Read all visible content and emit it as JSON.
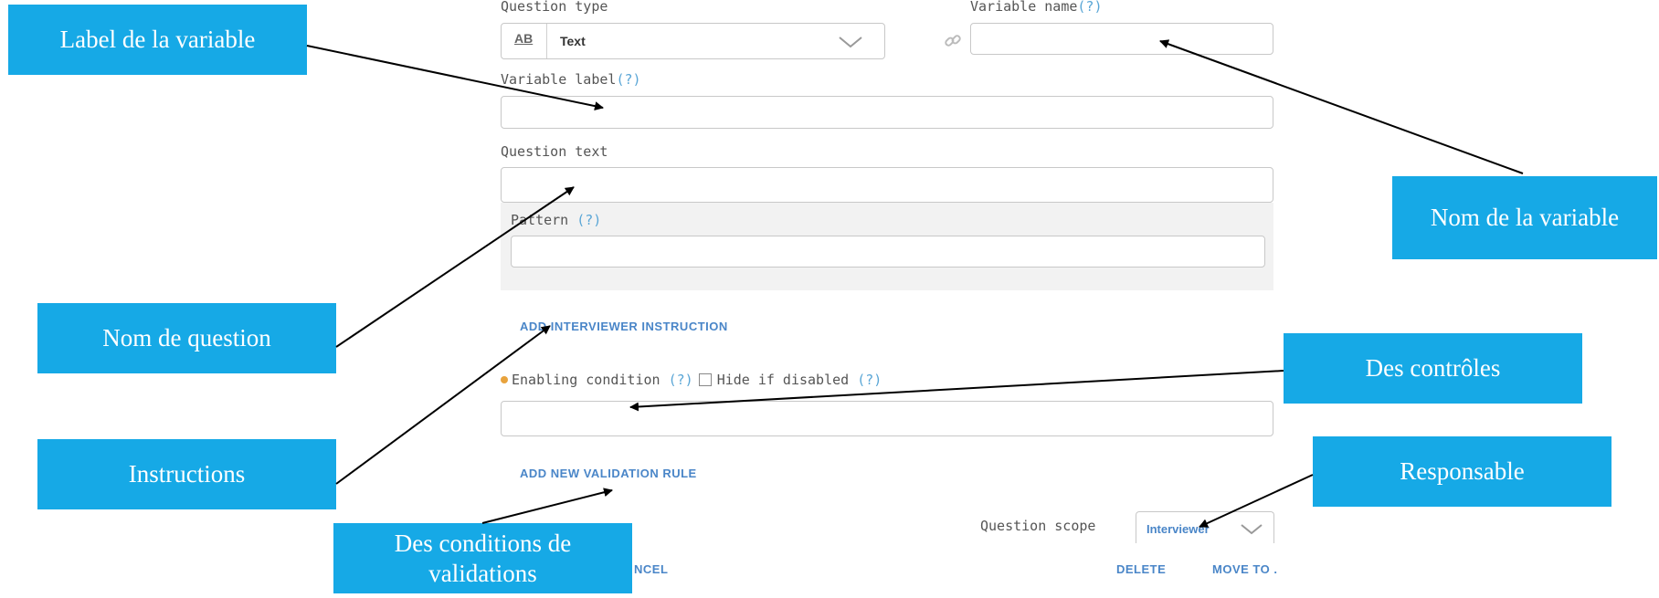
{
  "form": {
    "question_type_label": "Question type",
    "question_type_icon": "AB",
    "question_type_value": "Text",
    "variable_name_label": "Variable name",
    "variable_name_help": "(?)",
    "variable_name_value": "",
    "variable_label_label": "Variable label",
    "variable_label_help": "(?)",
    "variable_label_value": "",
    "question_text_label": "Question text",
    "question_text_value": "",
    "pattern_label": "Pattern",
    "pattern_help": "(?)",
    "pattern_value": "",
    "add_instruction_link": "ADD INTERVIEWER INSTRUCTION",
    "enabling_condition_label": "Enabling condition",
    "enabling_condition_help": "(?)",
    "hide_if_disabled_label": "Hide if disabled",
    "hide_if_disabled_help": "(?)",
    "hide_if_disabled_checked": false,
    "enabling_condition_value": "",
    "add_validation_link": "ADD NEW VALIDATION RULE",
    "question_scope_label": "Question scope",
    "question_scope_value": "Interviewer",
    "cancel_label": "NCEL",
    "delete_label": "DELETE",
    "move_to_label": "MOVE TO ."
  },
  "callouts": {
    "variable_label": "Label de la variable",
    "variable_name": "Nom de la variable",
    "question_name": "Nom de question",
    "controls": "Des contrôles",
    "instructions": "Instructions",
    "responsible": "Responsable",
    "validation_conditions": "Des conditions de validations"
  },
  "colors": {
    "callout_bg": "#16a9e6",
    "link": "#4a86c8",
    "help": "#5aa6d6",
    "condition_dot": "#e8a33d"
  }
}
